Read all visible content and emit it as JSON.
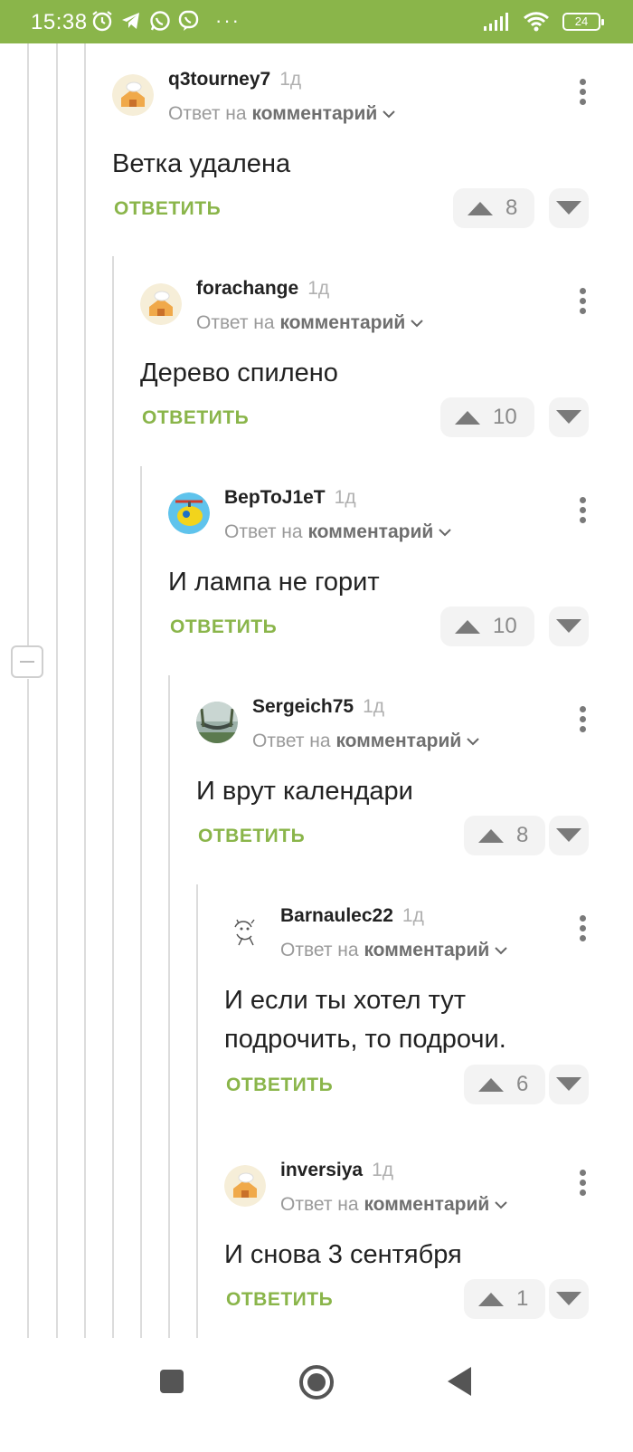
{
  "status_bar": {
    "time": "15:38",
    "battery": "24",
    "more": "···"
  },
  "comments": [
    {
      "author": "q3tourney7",
      "age": "1д",
      "reply_prefix": "Ответ на",
      "reply_target": "комментарий",
      "text": "Ветка удалена",
      "reply_label": "ОТВЕТИТЬ",
      "votes": "8",
      "avatar": "cook-house-avatar"
    },
    {
      "author": "forachange",
      "age": "1д",
      "reply_prefix": "Ответ на",
      "reply_target": "комментарий",
      "text": "Дерево спилено",
      "reply_label": "ОТВЕТИТЬ",
      "votes": "10",
      "avatar": "cook-house-avatar"
    },
    {
      "author": "BepToJ1eT",
      "age": "1д",
      "reply_prefix": "Ответ на",
      "reply_target": "комментарий",
      "text": "И лампа не горит",
      "reply_label": "ОТВЕТИТЬ",
      "votes": "10",
      "avatar": "helicopter-avatar"
    },
    {
      "author": "Sergeich75",
      "age": "1д",
      "reply_prefix": "Ответ на",
      "reply_target": "комментарий",
      "text": "И врут календари",
      "reply_label": "ОТВЕТИТЬ",
      "votes": "8",
      "avatar": "hammock-avatar"
    },
    {
      "author": "Barnaulec22",
      "age": "1д",
      "reply_prefix": "Ответ на",
      "reply_target": "комментарий",
      "text_line1": "И если ты хотел тут",
      "text_line2": "подрочить, то подрочи.",
      "reply_label": "ОТВЕТИТЬ",
      "votes": "6",
      "avatar": "sketch-avatar"
    },
    {
      "author": "inversiya",
      "age": "1д",
      "reply_prefix": "Ответ на",
      "reply_target": "комментарий",
      "text": "И снова 3 сентября",
      "reply_label": "ОТВЕТИТЬ",
      "votes": "1",
      "avatar": "cook-house-avatar"
    }
  ],
  "colors": {
    "accent": "#8ab54a",
    "statusbar": "#8ab54a"
  }
}
